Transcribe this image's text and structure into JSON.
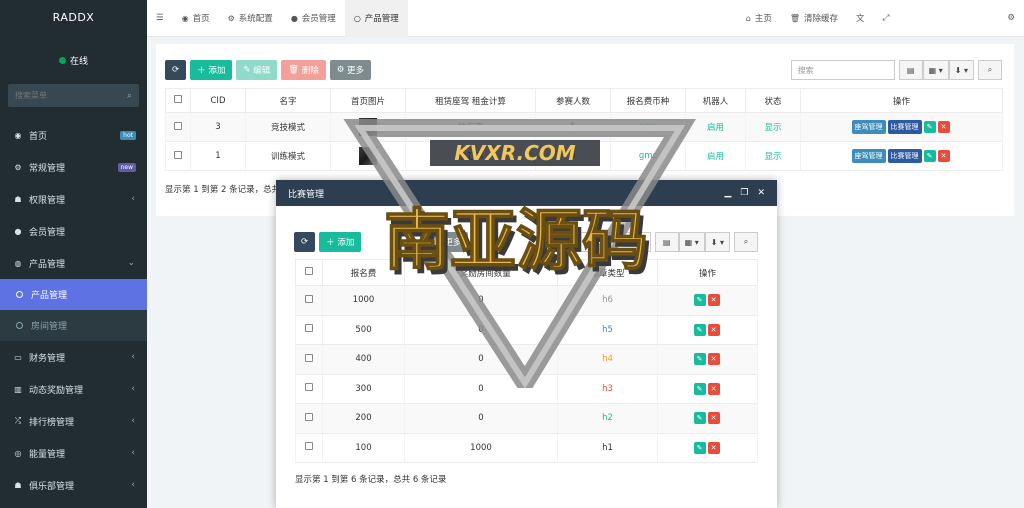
{
  "brand": "RADDX",
  "status": "在线",
  "sidebar": {
    "search_placeholder": "搜索菜单",
    "items": [
      {
        "icon": "dashboard-icon",
        "label": "首页",
        "badge": "hot"
      },
      {
        "icon": "cogs-icon",
        "label": "常规管理",
        "badge": "new"
      },
      {
        "icon": "group-icon",
        "label": "权限管理",
        "chevron": "‹"
      },
      {
        "icon": "user-icon",
        "label": "会员管理"
      },
      {
        "icon": "product-icon",
        "label": "产品管理",
        "chevron": "⌄"
      }
    ],
    "sub_items": [
      {
        "label": "产品管理",
        "active": true
      },
      {
        "label": "房间管理",
        "active": false
      }
    ],
    "items_after": [
      {
        "icon": "finance-icon",
        "label": "财务管理",
        "chevron": "‹"
      },
      {
        "icon": "reward-icon",
        "label": "动态奖励管理",
        "chevron": "‹"
      },
      {
        "icon": "rank-icon",
        "label": "排行榜管理",
        "chevron": "‹"
      },
      {
        "icon": "energy-icon",
        "label": "能量管理",
        "chevron": "‹"
      },
      {
        "icon": "club-icon",
        "label": "俱乐部管理",
        "chevron": "‹"
      }
    ]
  },
  "topbar": {
    "tabs": [
      {
        "label": "首页"
      },
      {
        "label": "系统配置"
      },
      {
        "label": "会员管理"
      },
      {
        "label": "产品管理"
      }
    ],
    "home_link": "主页",
    "clear_cache": "清除缓存"
  },
  "panel": {
    "toolbar": {
      "add": "添加",
      "edit": "编辑",
      "delete": "删除",
      "more": "更多"
    },
    "search_placeholder": "搜索",
    "columns": [
      "CID",
      "名字",
      "首页图片",
      "租赁座驾 租金计算",
      "参赛人数",
      "报名费币种",
      "机器人",
      "状态",
      "操作"
    ],
    "rows": [
      {
        "cid": "3",
        "name": "竞技模式",
        "calc": "按汇率",
        "count": "5",
        "currency": "gmc",
        "robot": "启用",
        "status": "显示"
      },
      {
        "cid": "1",
        "name": "训练模式",
        "calc": "按汇率",
        "count": "5",
        "currency": "gmc",
        "robot": "启用",
        "status": "显示"
      }
    ],
    "row_actions": {
      "seat": "座驾管理",
      "match": "比赛管理"
    },
    "footer": "显示第 1 到第 2 条记录，总共 2 条记录"
  },
  "modal": {
    "title": "比赛管理",
    "add": "添加",
    "more": "更多",
    "search": "搜索",
    "columns": [
      "报名费",
      "日奖励房间数量",
      "勋章类型",
      "操作"
    ],
    "rows": [
      {
        "fee": "1000",
        "qty": "0",
        "type": "h6"
      },
      {
        "fee": "500",
        "qty": "0",
        "type": "h5"
      },
      {
        "fee": "400",
        "qty": "0",
        "type": "h4"
      },
      {
        "fee": "300",
        "qty": "0",
        "type": "h3"
      },
      {
        "fee": "200",
        "qty": "0",
        "type": "h2"
      },
      {
        "fee": "100",
        "qty": "1000",
        "type": "h1"
      }
    ],
    "footer": "显示第 1 到第 6 条记录，总共 6 条记录"
  },
  "watermark": {
    "url": "KVXR.COM",
    "title": "南亚源码"
  }
}
